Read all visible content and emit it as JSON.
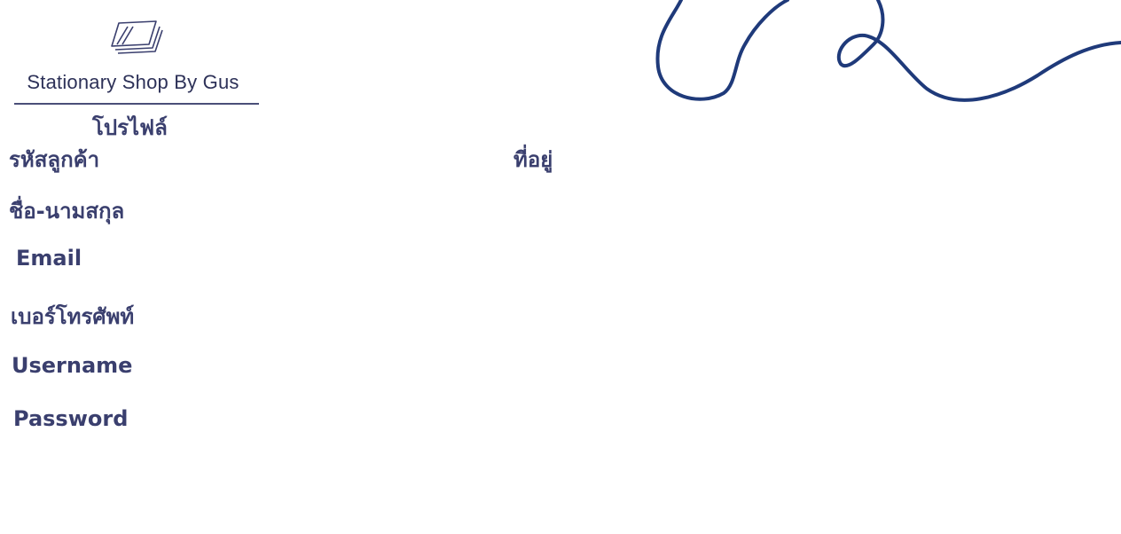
{
  "brand": {
    "name": "Stationary Shop By Gus",
    "logo_icon": "stacked-papers-icon"
  },
  "profile": {
    "title": "โปรไฟล์"
  },
  "fields": {
    "customer_id_label": "รหัสลูกค้า",
    "fullname_label": "ชื่อ-นามสกุล",
    "email_label": "Email",
    "phone_label": "เบอร์โทรศัพท์",
    "username_label": "Username",
    "password_label": "Password",
    "address_label": "ที่อยู่"
  },
  "colors": {
    "text": "#3a3f6e",
    "decoration": "#1f3a7a"
  }
}
